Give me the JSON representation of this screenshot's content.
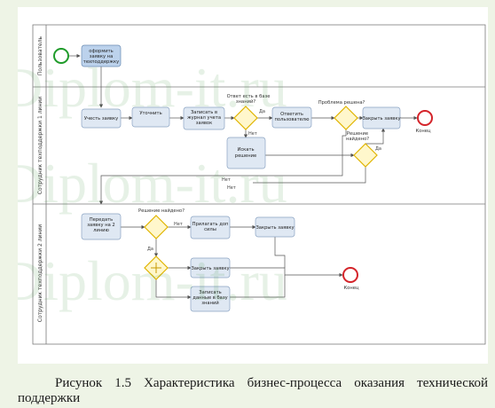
{
  "watermark": "Diplom-it.ru",
  "lanes": {
    "user": "Пользователь",
    "support1": "Сотрудник техподдержки 1 линии",
    "support2": "Сотрудник техподдержки 2 линии"
  },
  "tasks": {
    "submit_request": [
      "оформить",
      "заявку на",
      "техподдержку"
    ],
    "register_request": [
      "Учесть заявку"
    ],
    "clarify": [
      "Уточнить"
    ],
    "record_journal": [
      "Записать в",
      "журнал учета",
      "заявок"
    ],
    "reply_user": [
      "Ответить",
      "пользователю"
    ],
    "close_request1": [
      "Закрыть заявку"
    ],
    "search_solution": [
      "Искать",
      "решение"
    ],
    "forward_line2": [
      "Передать",
      "заявку на 2",
      "линию"
    ],
    "resolve_own": [
      "Прилагать доп",
      "силы"
    ],
    "close_request2": [
      "Закрыть заявку"
    ],
    "close_request3": [
      "Закрыть заявку"
    ],
    "record_kb": [
      "Записать",
      "данные в базу",
      "знаний"
    ]
  },
  "gateways": {
    "kb_answer": "Ответ есть в базе знаний?",
    "problem_solved": "Проблема решена?",
    "solution_found1": [
      "Решение",
      "найдено?"
    ],
    "solution_found2": "Решение найдено?"
  },
  "flow_labels": {
    "yes": "Да",
    "no": "Нет"
  },
  "events": {
    "end1": "Конец",
    "end2": "Конец"
  },
  "colors": {
    "task_fill": "#dfe8f3",
    "task_fill_highlight": "#bcd2ec",
    "gateway_fill": "#fff7cc",
    "gateway_stroke": "#e0b400",
    "start_stroke": "#1f9b2a",
    "end_stroke": "#d4242a",
    "watermark": "#3f8f3f"
  },
  "caption": "Рисунок 1.5 Характеристика бизнес-процесса оказания технической поддержки"
}
